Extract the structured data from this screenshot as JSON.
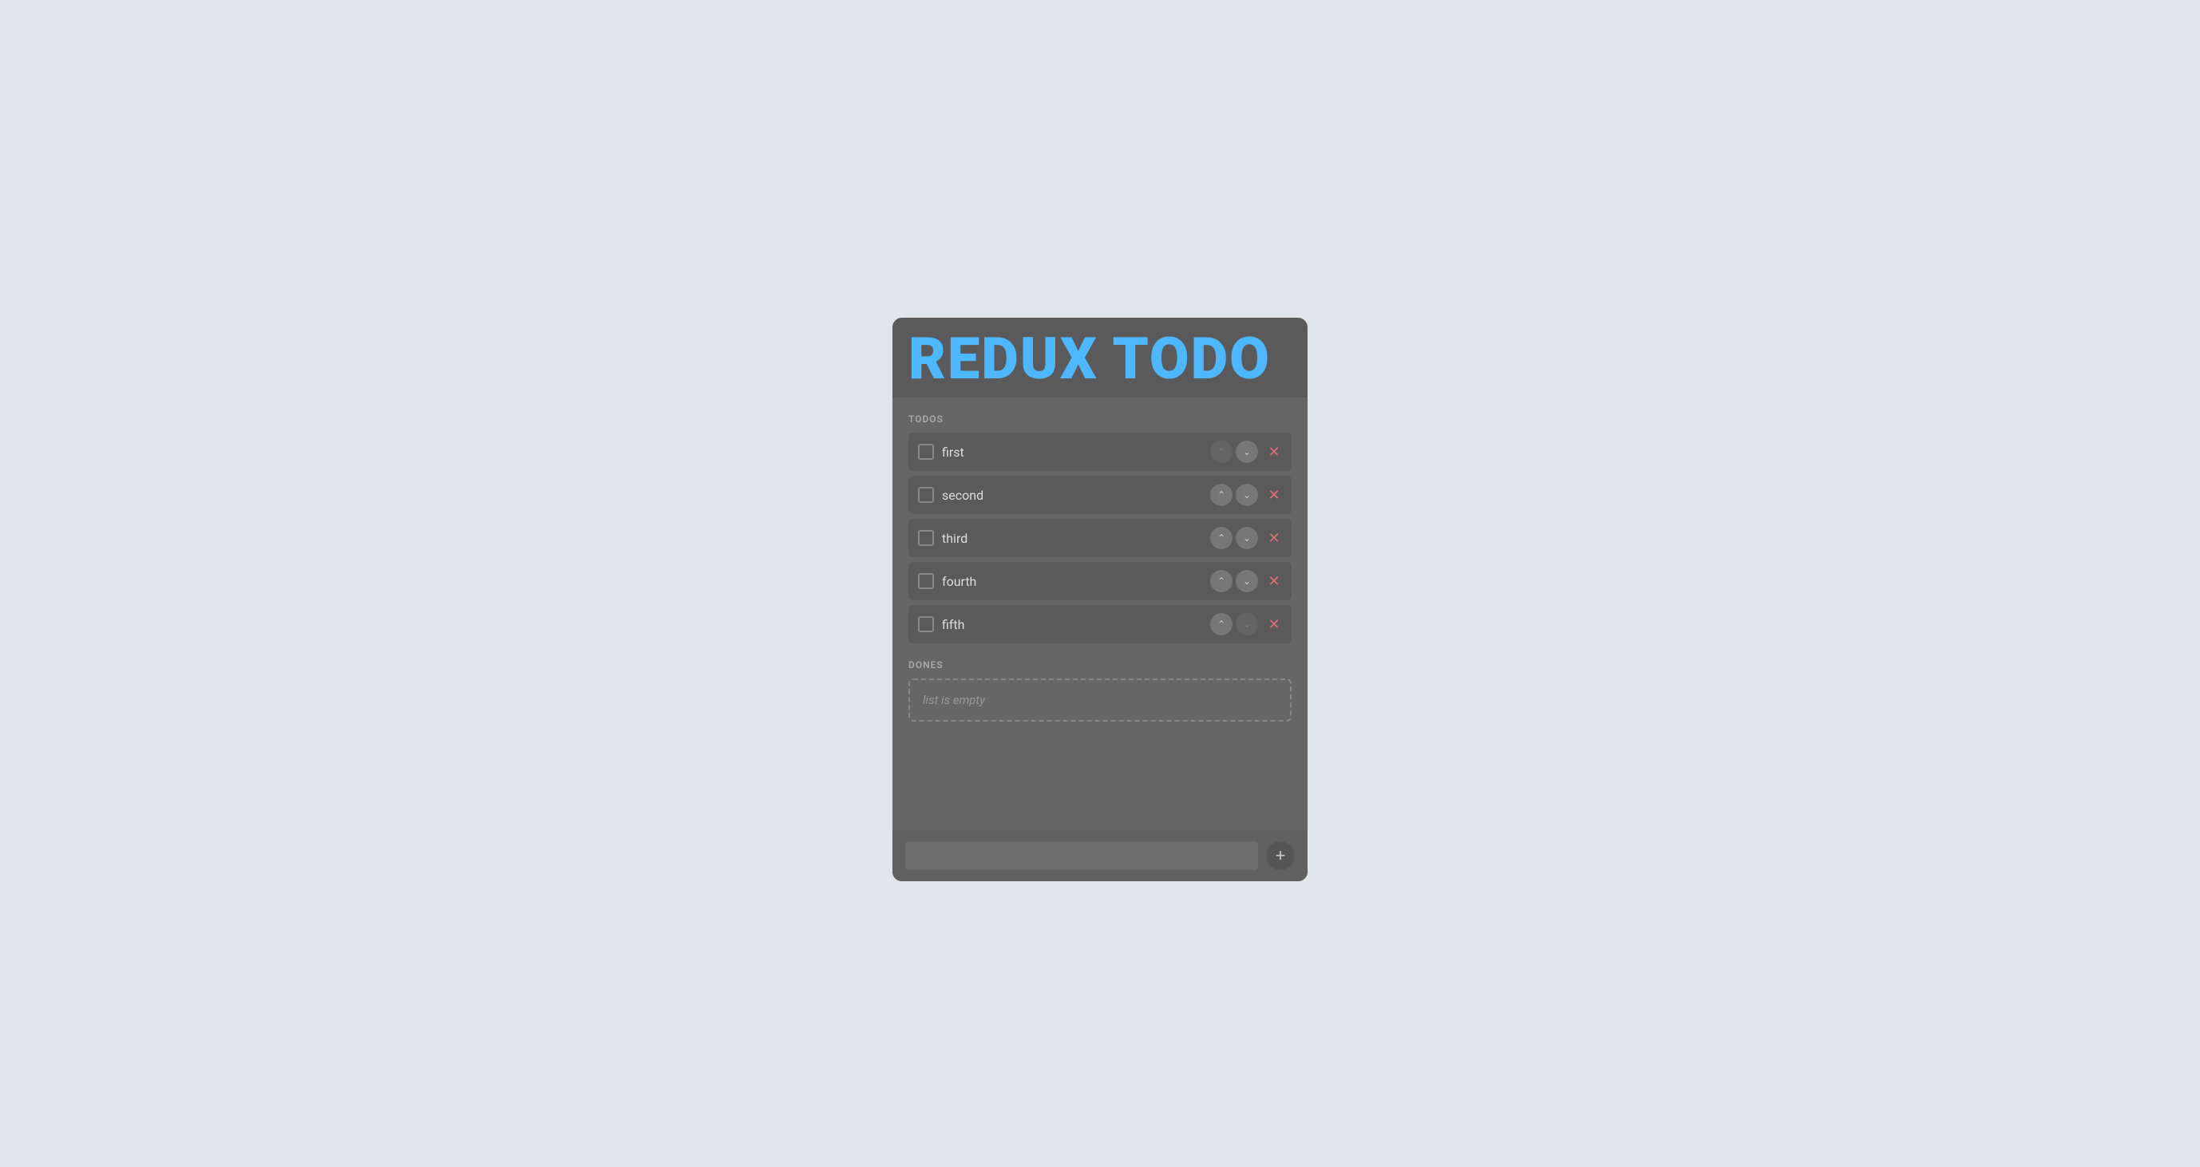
{
  "app": {
    "title": "REDUX TODO"
  },
  "todos_label": "TODOS",
  "dones_label": "DONES",
  "todos": [
    {
      "id": 1,
      "text": "first",
      "checked": false,
      "has_up": false,
      "has_down": true
    },
    {
      "id": 2,
      "text": "second",
      "checked": false,
      "has_up": true,
      "has_down": true
    },
    {
      "id": 3,
      "text": "third",
      "checked": false,
      "has_up": true,
      "has_down": true
    },
    {
      "id": 4,
      "text": "fourth",
      "checked": false,
      "has_up": true,
      "has_down": true
    },
    {
      "id": 5,
      "text": "fifth",
      "checked": false,
      "has_up": true,
      "has_down": false
    }
  ],
  "dones": [],
  "dones_empty_label": "list is empty",
  "add_input_placeholder": "",
  "add_button_label": "+"
}
